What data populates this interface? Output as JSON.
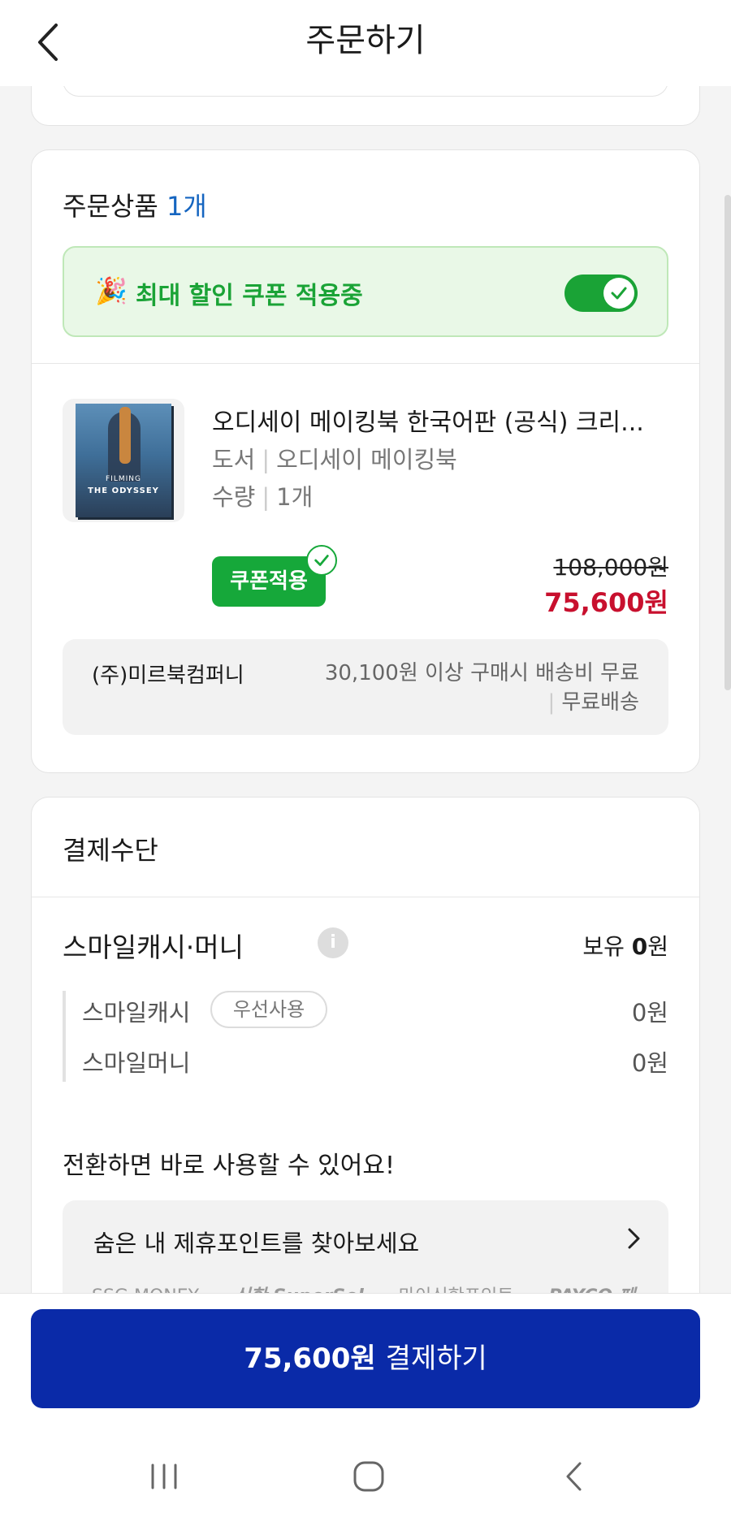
{
  "header": {
    "title": "주문하기",
    "back_icon": "chevron-left-icon"
  },
  "order": {
    "section_label": "주문상품",
    "count_label": "1개",
    "coupon_banner": {
      "emoji": "🎉",
      "text": "최대 할인 쿠폰 적용중",
      "toggle_on": true
    },
    "product": {
      "name": "오디세이 메이킹북 한국어판 (공식) 크리...",
      "category": "도서",
      "series": "오디세이 메이킹북",
      "qty_label": "수량",
      "qty_value": "1개",
      "cover_line1": "FILMING",
      "cover_line2": "THE ODYSSEY",
      "coupon_badge": "쿠폰적용",
      "original_price": "108,000원",
      "sale_price": "75,600원"
    },
    "seller": {
      "name": "(주)미르북컴퍼니",
      "shipping_condition": "30,100원 이상 구매시 배송비 무료",
      "shipping_type": "무료배송"
    }
  },
  "payment": {
    "section_label": "결제수단",
    "smile_title": "스마일캐시·머니",
    "balance_label": "보유",
    "balance_value": "0",
    "balance_unit": "원",
    "rows": [
      {
        "label": "스마일캐시",
        "chip": "우선사용",
        "amount": "0원"
      },
      {
        "label": "스마일머니",
        "amount": "0원"
      }
    ],
    "convert_text": "전환하면 바로 사용할 수 있어요!",
    "points_link": "숨은 내 제휴포인트를 찾아보세요",
    "partner_logos": [
      "SSG MONEY",
      "신한 SuperSol",
      "마이신한포인트",
      "PAYCO 페"
    ]
  },
  "pay_button": {
    "amount": "75,600원",
    "label": "결제하기"
  },
  "colors": {
    "accent_blue": "#0a2aa8",
    "coupon_green": "#1aa336",
    "price_red": "#c8102e",
    "count_blue": "#1565c0"
  }
}
